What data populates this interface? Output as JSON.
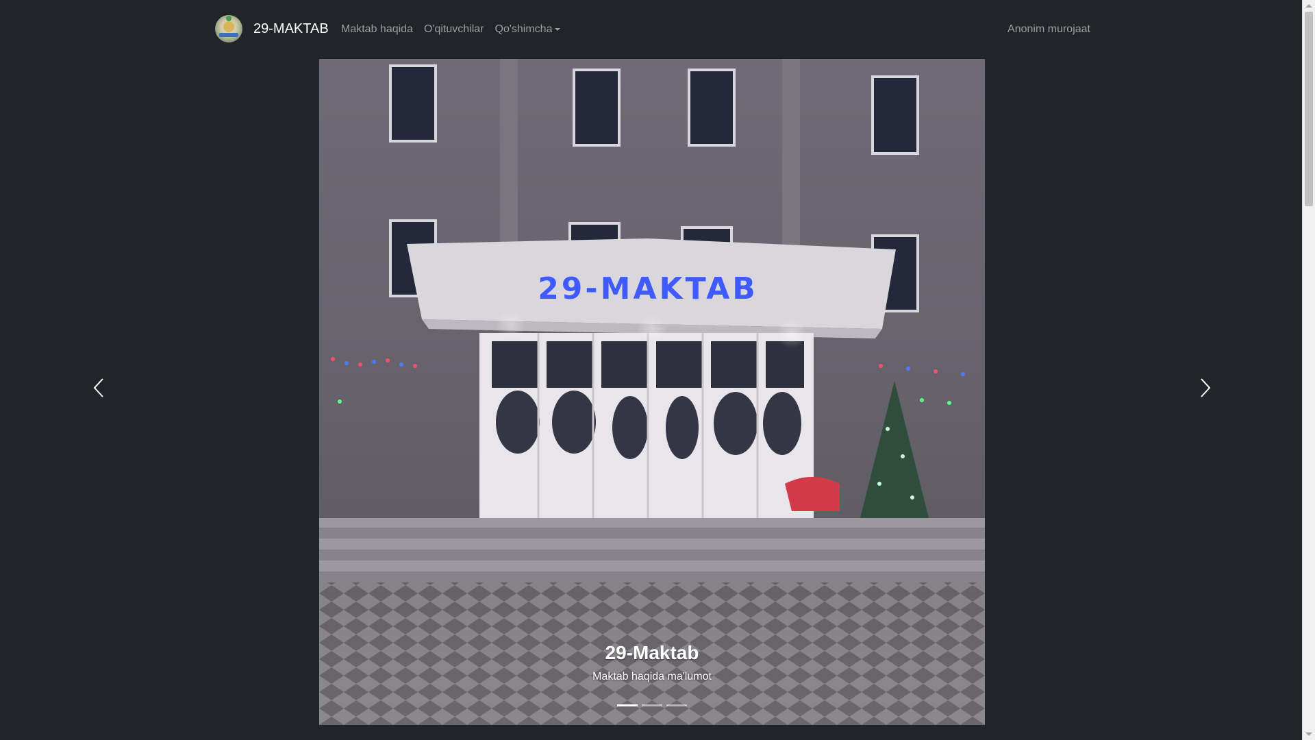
{
  "navbar": {
    "brand": "29-MAKTAB",
    "links": [
      "Maktab haqida",
      "O'qituvchilar",
      "Qo'shimcha"
    ],
    "right_link": "Anonim murojaat"
  },
  "carousel": {
    "slide_sign_text": "29-MAKTAB",
    "caption_title": "29-Maktab",
    "caption_subtitle": "Maktab haqida ma'lumot",
    "indicator_count": 3,
    "active_index": 0
  },
  "colors": {
    "background": "#212529",
    "nav_link": "rgba(255,255,255,0.55)",
    "sign_glow": "#3f5bff"
  },
  "icons": {
    "brand_logo": "school-emblem-icon",
    "prev": "chevron-left-icon",
    "next": "chevron-right-icon",
    "dropdown": "caret-down-icon"
  }
}
